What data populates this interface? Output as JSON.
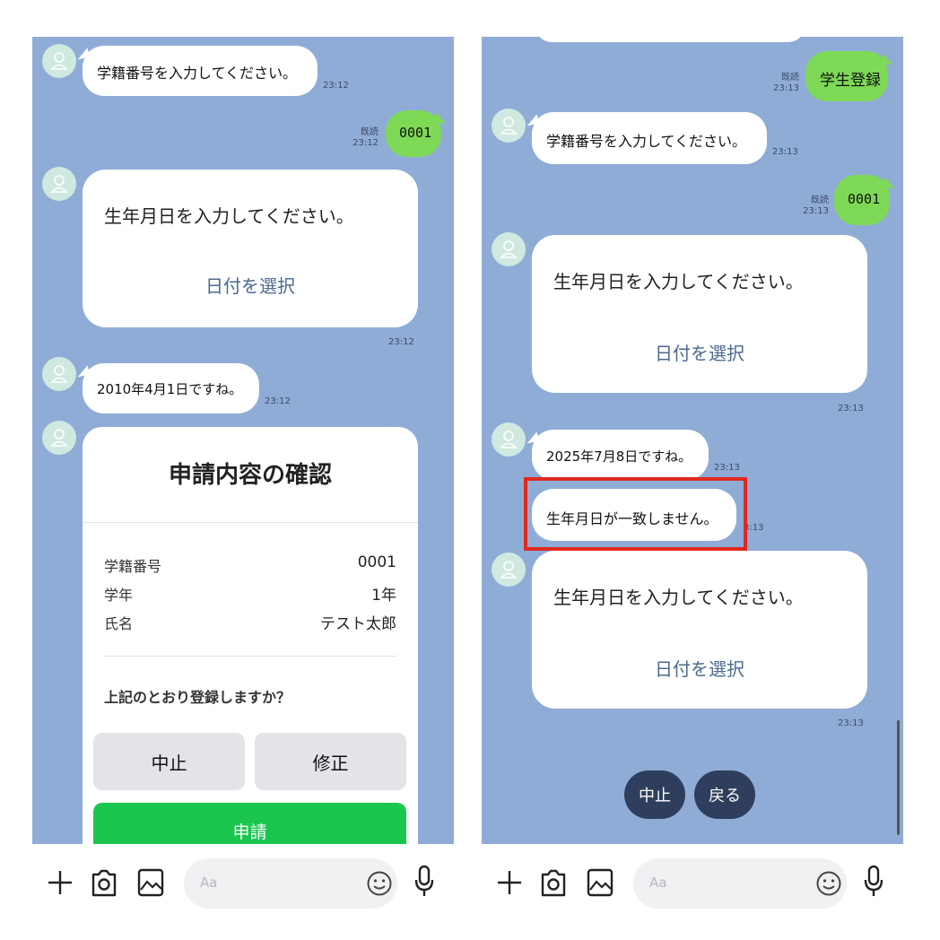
{
  "left": {
    "msg_student_id_prompt": "学籍番号を入力してください。",
    "time_1": "23:12",
    "read_label": "既読",
    "time_2": "23:12",
    "out_student_id": "0001",
    "dob_prompt": "生年月日を入力してください。",
    "select_date": "日付を選択",
    "time_3": "23:12",
    "dob_echo": "2010年4月1日ですね。",
    "time_4": "23:12",
    "confirm": {
      "title": "申請内容の確認",
      "rows": [
        {
          "label": "学籍番号",
          "value": "0001"
        },
        {
          "label": "学年",
          "value": "1年"
        },
        {
          "label": "氏名",
          "value": "テスト太郎"
        }
      ],
      "question": "上記のとおり登録しますか？",
      "cancel_label": "中止",
      "edit_label": "修正",
      "apply_label": "申請"
    }
  },
  "right": {
    "read_label_1": "既読",
    "time_out_1": "23:13",
    "out_register": "学生登録",
    "msg_student_id_prompt": "学籍番号を入力してください。",
    "time_1": "23:13",
    "read_label_2": "既読",
    "time_out_2": "23:13",
    "out_student_id": "0001",
    "dob_prompt": "生年月日を入力してください。",
    "select_date": "日付を選択",
    "time_2": "23:13",
    "dob_echo": "2025年7月8日ですね。",
    "time_3": "23:13",
    "mismatch": "生年月日が一致しません。",
    "time_4": "3:13",
    "dob_prompt_2": "生年月日を入力してください。",
    "select_date_2": "日付を選択",
    "time_5": "23:13",
    "quick_cancel": "中止",
    "quick_back": "戻る"
  },
  "toolbar": {
    "input_placeholder": "Aa"
  },
  "colors": {
    "chat_bg": "#8facd6",
    "outgoing": "#7ed957",
    "apply_green": "#1bc64f",
    "highlight": "#e0281e",
    "quick_reply": "#2f3e5c"
  }
}
